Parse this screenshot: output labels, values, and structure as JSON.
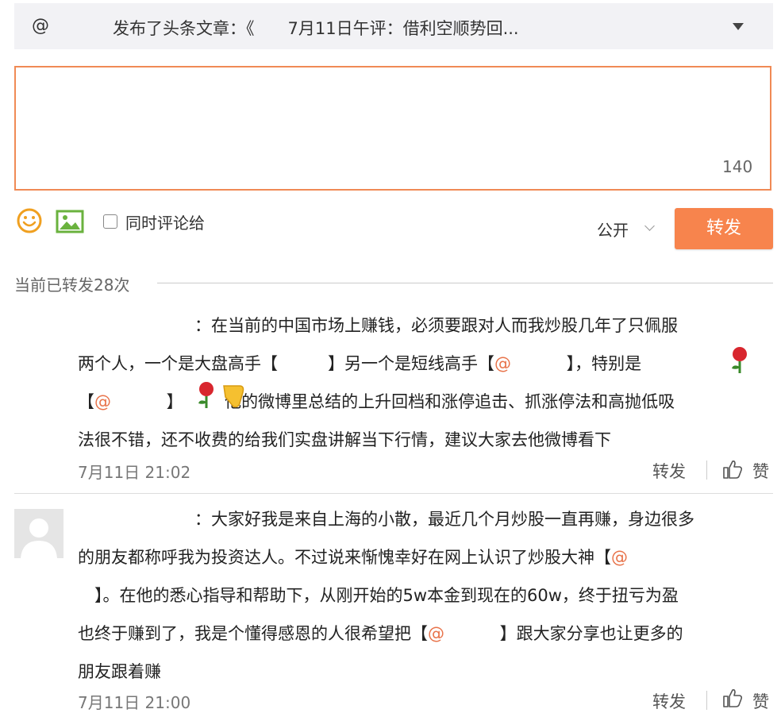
{
  "share_bar": {
    "at_symbol": "@",
    "title": "发布了头条文章：《　　7月11日午评：借利空顺势回..."
  },
  "compose": {
    "char_count": "140"
  },
  "toolbar": {
    "also_comment_label": "同时评论给",
    "visibility_label": "公开",
    "forward_button": "转发"
  },
  "repost_count_label": "当前已转发28次",
  "comments": [
    {
      "lines": [
        "　　　　　　　：在当前的中国市场上赚钱，必须要跟对人而我炒股几年了只佩服",
        "两个人，一个是大盘高手【　　　】另一个是短线高手【@　　　 】，特别是",
        "【@　　　 】　　　他的微博里总结的上升回档和涨停追击、抓涨停法和高抛低吸",
        "法很不错，还不收费的给我们实盘讲解当下行情，建议大家去他微博看下"
      ],
      "time": "7月11日 21:02",
      "forward_label": "转发",
      "like_label": "赞"
    },
    {
      "lines": [
        "　　　　　　　：大家好我是来自上海的小散，最近几个月炒股一直再赚，身边很多",
        "的朋友都称呼我为投资达人。不过说来惭愧幸好在网上认识了炒股大神【@",
        "　】。在他的悉心指导和帮助下，从刚开始的5w本金到现在的60w，终于扭亏为盈",
        "也终于赚到了，我是个懂得感恩的人很希望把【@　　　 】跟大家分享也让更多的",
        "朋友跟着赚"
      ],
      "time": "7月11日 21:00",
      "forward_label": "转发",
      "like_label": "赞"
    }
  ],
  "colors": {
    "accent": "#f7844d",
    "mention": "#e8734a",
    "border": "#f08a55"
  }
}
